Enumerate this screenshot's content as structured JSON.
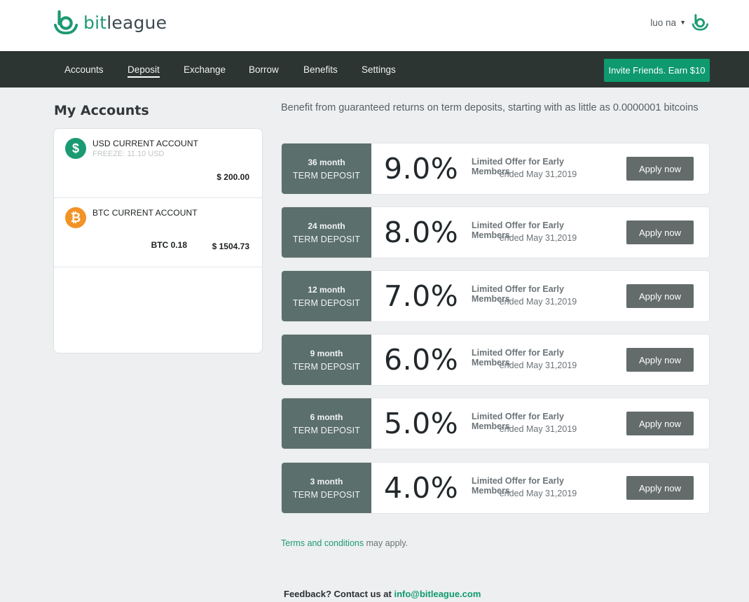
{
  "brand": {
    "name_part1": "bit",
    "name_part2": "league",
    "logo_icon": "bitleague-logo-icon",
    "accent_color": "#1e9a73"
  },
  "user": {
    "name": "luo na",
    "chevron_icon": "chevron-down-icon",
    "avatar_icon": "bitleague-avatar-icon"
  },
  "nav": {
    "items": [
      {
        "label": "Accounts",
        "active": false
      },
      {
        "label": "Deposit",
        "active": true
      },
      {
        "label": "Exchange",
        "active": false
      },
      {
        "label": "Borrow",
        "active": false
      },
      {
        "label": "Benefits",
        "active": false
      },
      {
        "label": "Settings",
        "active": false
      }
    ],
    "invite_label": "Invite Friends. Earn $10"
  },
  "accounts": {
    "title": "My Accounts",
    "items": [
      {
        "icon": "dollar-icon",
        "name": "USD CURRENT ACCOUNT",
        "sub": "FREEZE: 11.10 USD",
        "amount": "$ 200.00"
      },
      {
        "icon": "bitcoin-icon",
        "name": "BTC CURRENT ACCOUNT",
        "btc_amount": "BTC 0.18",
        "amount": "$ 1504.73"
      }
    ]
  },
  "deposits": {
    "intro": "Benefit from guaranteed returns on term deposits, starting with as little as 0.0000001 bitcoins",
    "term_label": "TERM DEPOSIT",
    "offer_title": "Limited Offer for Early Members",
    "offer_date": "ended May 31,2019",
    "apply_label": "Apply now",
    "items": [
      {
        "month": "36 month",
        "rate": "9.0%"
      },
      {
        "month": "24 month",
        "rate": "8.0%"
      },
      {
        "month": "12 month",
        "rate": "7.0%"
      },
      {
        "month": "9 month",
        "rate": "6.0%"
      },
      {
        "month": "6 month",
        "rate": "5.0%"
      },
      {
        "month": "3 month",
        "rate": "4.0%"
      }
    ]
  },
  "terms": {
    "link": "Terms and conditions",
    "suffix": " may apply."
  },
  "footer": {
    "prefix": "Feedback? Contact us at ",
    "email": "info@bitleague.com"
  }
}
